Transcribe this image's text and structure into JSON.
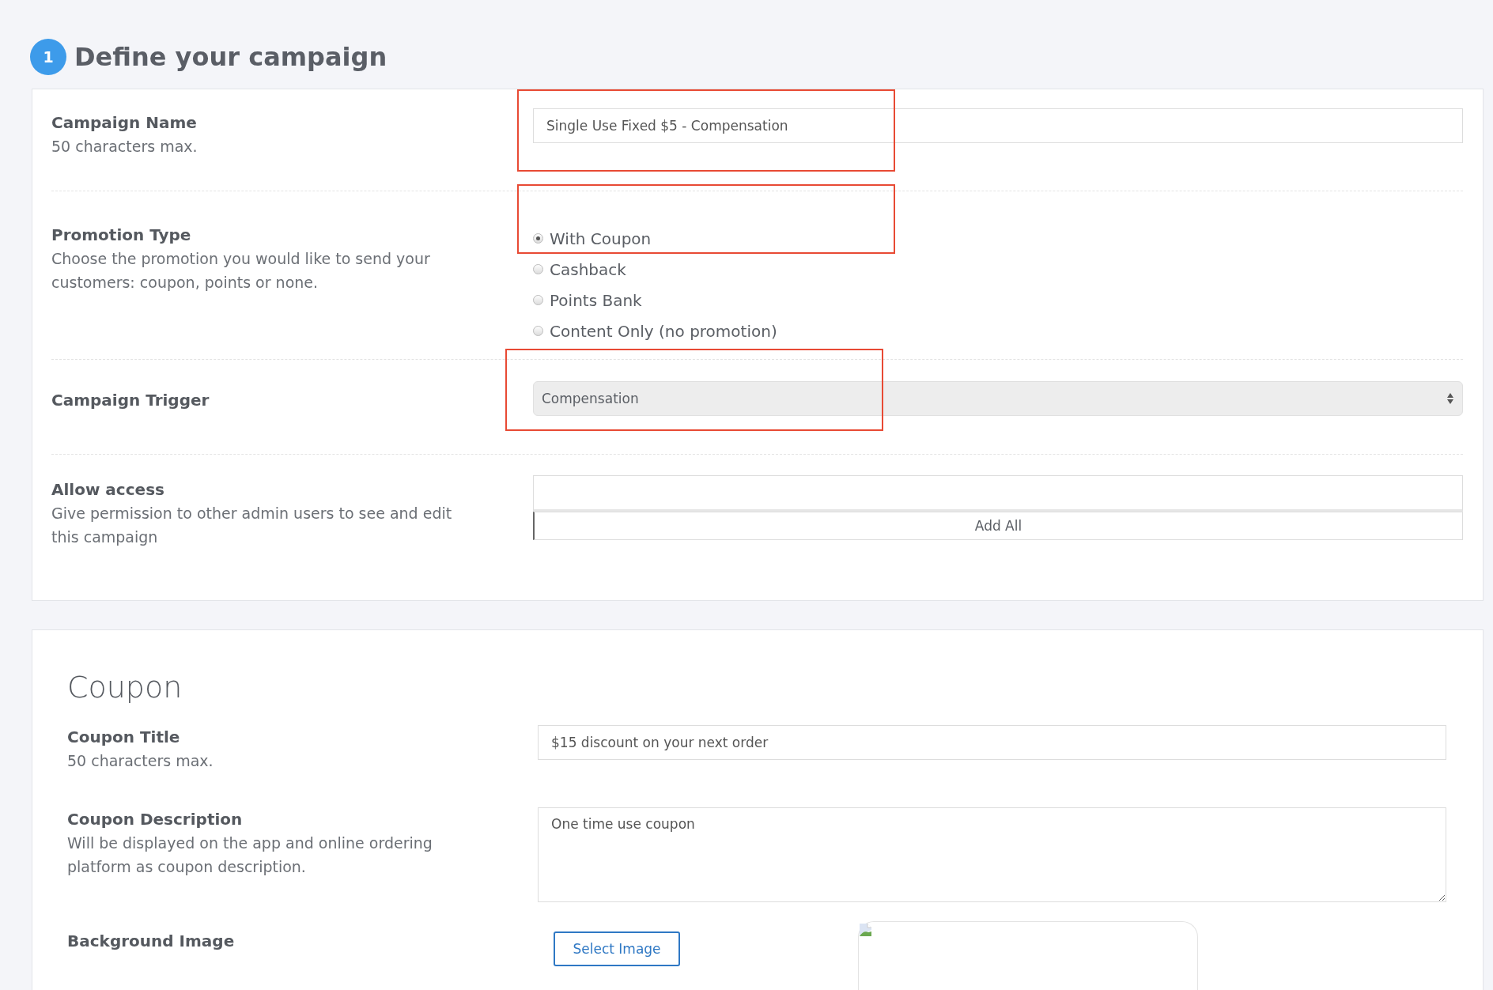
{
  "step": {
    "number": "1",
    "title": "Define your campaign"
  },
  "campaign_name": {
    "label": "Campaign Name",
    "hint": "50 characters max.",
    "value": "Single Use Fixed $5 - Compensation"
  },
  "promotion_type": {
    "label": "Promotion Type",
    "hint": "Choose the promotion you would like to send your customers: coupon, points or none.",
    "options": [
      {
        "label": "With Coupon",
        "selected": true
      },
      {
        "label": "Cashback",
        "selected": false
      },
      {
        "label": "Points Bank",
        "selected": false
      },
      {
        "label": "Content Only (no promotion)",
        "selected": false
      }
    ]
  },
  "campaign_trigger": {
    "label": "Campaign Trigger",
    "value": "Compensation"
  },
  "allow_access": {
    "label": "Allow access",
    "hint": "Give permission to other admin users to see and edit this campaign",
    "button": "Add All"
  },
  "coupon": {
    "heading": "Coupon",
    "title": {
      "label": "Coupon Title",
      "hint": "50 characters max.",
      "value": "$15 discount on your next order"
    },
    "description": {
      "label": "Coupon Description",
      "hint": "Will be displayed on the app and online ordering platform as coupon description.",
      "value": "One time use coupon"
    },
    "background_image": {
      "label": "Background Image",
      "button": "Select Image"
    }
  }
}
